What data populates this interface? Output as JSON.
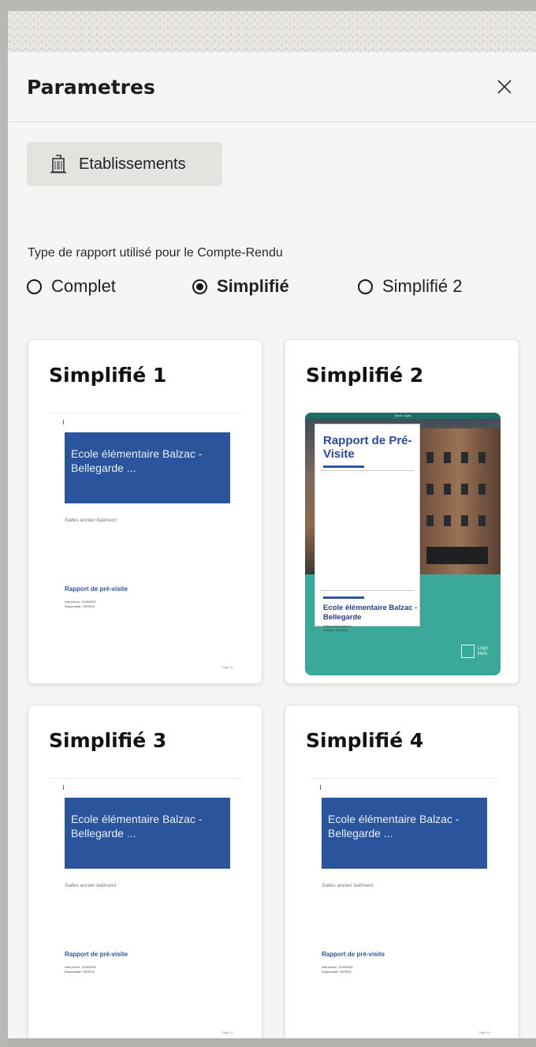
{
  "panel": {
    "title": "Parametres",
    "close_icon": "close-icon"
  },
  "establishments_button": {
    "label": "Etablissements",
    "icon": "building-icon"
  },
  "report_type": {
    "label": "Type de rapport utilisé pour le Compte-Rendu",
    "options": [
      {
        "label": "Complet",
        "selected": false
      },
      {
        "label": "Simplifié",
        "selected": true
      },
      {
        "label": "Simplifié 2",
        "selected": false
      }
    ]
  },
  "templates": [
    {
      "title": "Simplifié 1",
      "school": "Ecole élémentaire Balzac - Bellegarde ...",
      "subtitle": "Salles ancien batiment",
      "report_label": "Rapport de pré-visite",
      "meta_line1": "Date prévue : 02/06/2023",
      "meta_line2": "Responsable : PATRICE",
      "page": "Page 1/1"
    },
    {
      "title": "Simplifié 2",
      "top_strip": "[Nom Orgé]",
      "cover_title": "Rapport de Pré-Visite",
      "school": "Ecole élémentaire Balzac - Bellegarde",
      "small_line1": "Salles ancien batiment",
      "small_line2": "Créé par : [Contact]",
      "logo_line1": "Logo",
      "logo_line2": "Nom"
    },
    {
      "title": "Simplifié 3",
      "school": "Ecole élémentaire Balzac - Bellegarde ...",
      "subtitle": "Salles ancien batiment",
      "report_label": "Rapport de pré-visite",
      "meta_line1": "Date prévue : 02/06/2023",
      "meta_line2": "Responsable : PATRICE",
      "page": "Page 1/1"
    },
    {
      "title": "Simplifié 4",
      "school": "Ecole élémentaire Balzac - Bellegarde ...",
      "subtitle": "Salles ancien batiment",
      "report_label": "Rapport de pré-visite",
      "meta_line1": "Date prévue : 02/06/2023",
      "meta_line2": "Responsable : PATRICE",
      "page": "Page 1/1"
    }
  ],
  "colors": {
    "doc_blue": "#2a559c",
    "cover_teal": "#3aa99a",
    "report_blue": "#2a55a8"
  }
}
